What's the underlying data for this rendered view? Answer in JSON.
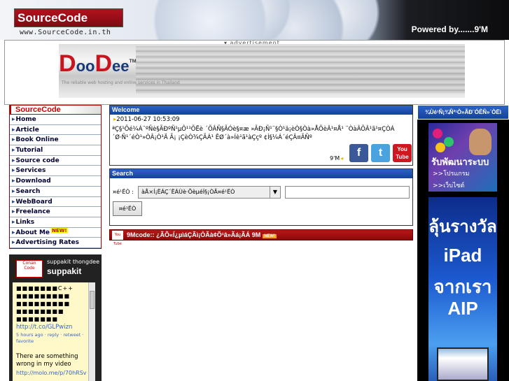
{
  "header": {
    "logo_text": "SourceCode",
    "logo_url": "www.SourceCode.in.th",
    "powered": "Powered by.......9'M"
  },
  "advertisement": {
    "label": "▾ advertisement",
    "logo": "DooDee",
    "logo_sup": "TM",
    "tagline": "The reliable web hosting and online services in Thailand"
  },
  "sidebar": {
    "heading": "SourceCode",
    "items": [
      {
        "label": "Home"
      },
      {
        "label": "Article"
      },
      {
        "label": "Book Online"
      },
      {
        "label": "Tutorial"
      },
      {
        "label": "Source code"
      },
      {
        "label": "Services"
      },
      {
        "label": "Download"
      },
      {
        "label": "Search"
      },
      {
        "label": "WebBoard"
      },
      {
        "label": "Freelance"
      },
      {
        "label": "Links"
      },
      {
        "label": "About Me",
        "badge": "NEW!"
      },
      {
        "label": "Advertising Rates"
      }
    ]
  },
  "twitter": {
    "avatar_text": "Conan Code",
    "full_name": "suppakit thongdee",
    "username": "suppakit",
    "tweet1_text": "■■■■■■■C++",
    "tweet1_line2": "■■■■■■■■■",
    "tweet1_line3": "■■■■■■■■■",
    "tweet1_line4": "■■■■■■■■",
    "tweet1_line5": "■■■■■■■",
    "tweet1_link": "http://t.co/GLPwizn",
    "tweet1_meta": "5 hours ago · reply · retweet · favorite",
    "tweet2_text": "There are something wrong in my video",
    "tweet2_link": "http://molo.me/p/70hRSv"
  },
  "welcome": {
    "title": "Welcome",
    "datetime": "2011-06-27 10:53:09",
    "text": "ªÇ§¹Õé¼Á¨ºÑè§ÃÐºÑ¹µÔ¹¹ÕËè ´ÕÂÑ§ÃÓè§¤æ »ÃÐ¡Ñ¹¨§Ò¹ä¡èÒ§Òà»ÅÕèÂ¹¤Å¹ ¨ÒàÂÕÂ¹ã¹¤ÇÒÁ´Ø·Ñ¹´éÒ¹»ÒÂ¡Ò¹Ä Ã¡ ¡ÇèÒ¾ÇÃÁ¹ ÊØ´à»Íè¹ã¹àÇçº ¢Í§¼Á´éÇÂ¤ÃÑº",
    "signature": "9'M",
    "social": [
      {
        "name": "facebook",
        "glyph": "f",
        "color": "#3b5998"
      },
      {
        "name": "twitter",
        "glyph": "t",
        "color": "#4aa3df"
      },
      {
        "name": "youtube",
        "glyph": "You Tube",
        "color": "#cc181e"
      }
    ]
  },
  "search": {
    "title": "Search",
    "label": "¤é¹ËÒ :",
    "category": "àÅ×Í¡ËÁÇ´ËÁÙè·ÕèµéÍ§¡ÒÃ¤é¹ËÒ",
    "input_value": "",
    "button": "¤é¹ËÒ"
  },
  "youtube_bar": {
    "icon_text": "You Tube",
    "title": "9Mcode:: ¿ÃÕ«Í¿µìáÇÃì¡ÒÃà¢Õ¹â»Ãá¡ÃÁ 9M",
    "badge": "NEW!"
  },
  "right": {
    "heading": "¾Ùé¹Ñ¡¾Ñ²¹Ò»ÃÐ¨ÓÊÑ»´ÒËì",
    "banner1_title": "รับพัฒนาระบบ",
    "banner1_line1": ">>โปรแกรม",
    "banner1_line2": ">>เว็บไซต์",
    "banner2_line1": "ลุ้นรางวัล",
    "banner2_line2": "iPad",
    "banner2_line3": "จากเรา",
    "banner2_line4": "AIP"
  }
}
